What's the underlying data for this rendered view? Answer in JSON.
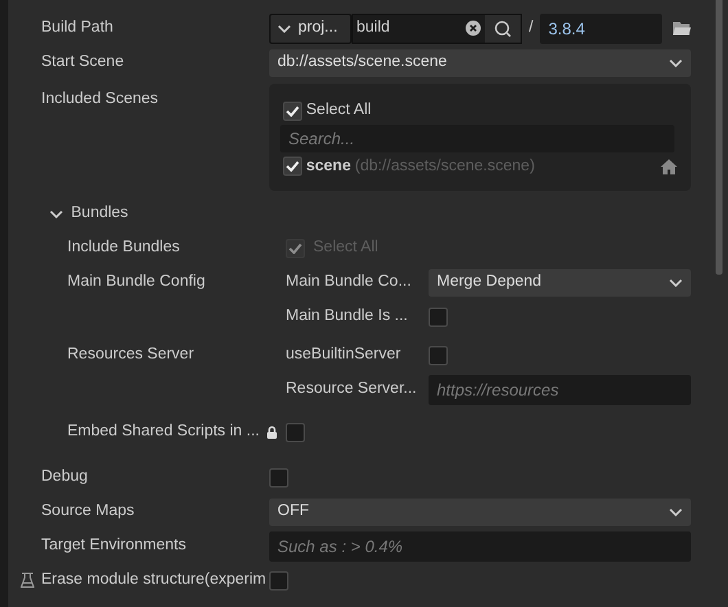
{
  "settings": [
    {
      "kind": "path",
      "label": "Build Path",
      "source": "proj...",
      "value": "build",
      "separator": "/",
      "version": "3.8.4"
    },
    {
      "kind": "select",
      "label": "Start Scene",
      "value": "db://assets/scene.scene"
    },
    {
      "kind": "scenes",
      "label": "Included Scenes",
      "select_all": {
        "label": "Select All",
        "checked": true
      },
      "search": {
        "placeholder": "Search..."
      },
      "scenes": [
        {
          "name": "scene",
          "path": "(db://assets/scene.scene)",
          "checked": true
        }
      ]
    },
    {
      "kind": "group",
      "label": "Bundles",
      "expanded": true,
      "children": [
        {
          "kind": "checktext",
          "label": "Include Bundles",
          "text": "Select All",
          "checked": true,
          "disabled": true
        },
        {
          "kind": "subgroup",
          "label": "Main Bundle Config",
          "children": [
            {
              "kind": "select",
              "label": "Main Bundle Co...",
              "value": "Merge Depend"
            },
            {
              "kind": "checkbox",
              "label": "Main Bundle Is ...",
              "checked": false
            }
          ]
        },
        {
          "kind": "subgroup",
          "label": "Resources Server",
          "children": [
            {
              "kind": "checkbox",
              "label": "useBuiltinServer",
              "checked": false
            },
            {
              "kind": "input",
              "label": "Resource Server...",
              "placeholder": "https://resources"
            }
          ]
        },
        {
          "kind": "checkbox",
          "label": "Embed Shared Scripts in ...",
          "locked": true,
          "checked": false
        }
      ]
    },
    {
      "kind": "checkbox",
      "label": "Debug",
      "checked": false
    },
    {
      "kind": "select",
      "label": "Source Maps",
      "value": "OFF"
    },
    {
      "kind": "input",
      "label": "Target Environments",
      "placeholder": "Such as : > 0.4%"
    },
    {
      "kind": "checkbox",
      "label": "Erase module structure(experim",
      "experimental": true,
      "checked": false
    }
  ]
}
